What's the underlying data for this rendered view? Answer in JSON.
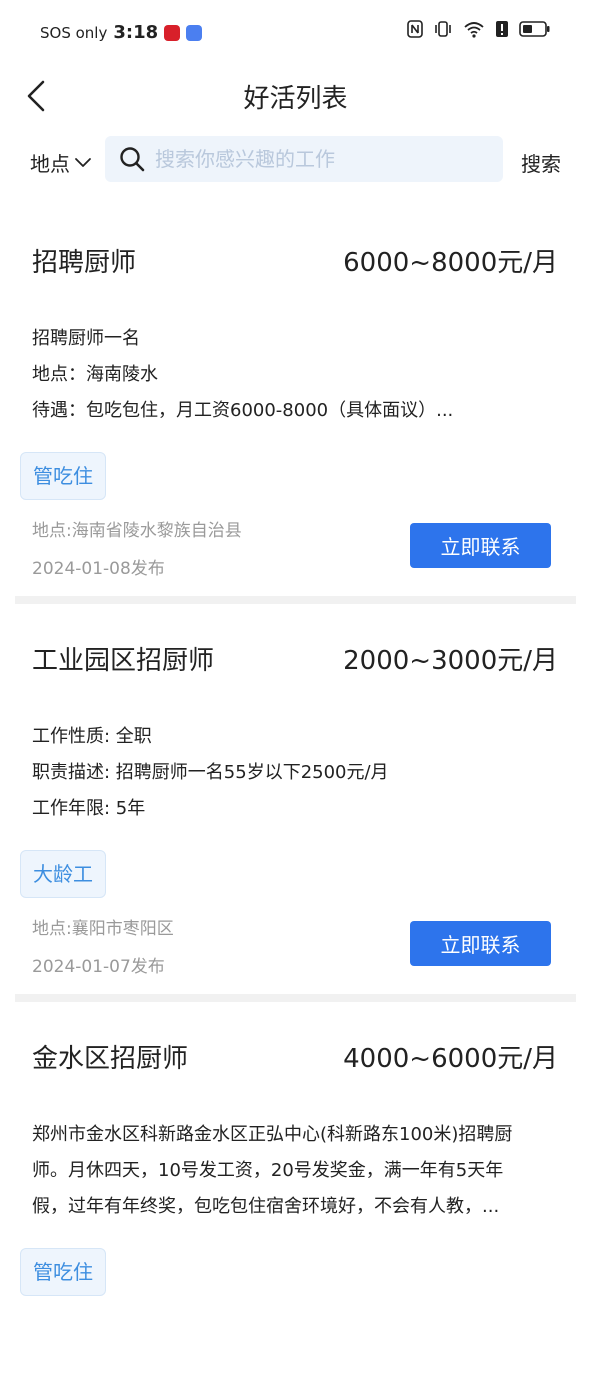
{
  "status_bar": {
    "carrier": "SOS only",
    "time": "3:18"
  },
  "header": {
    "title": "好活列表"
  },
  "search": {
    "location_label": "地点",
    "placeholder": "搜索你感兴趣的工作",
    "value": "",
    "button_label": "搜索"
  },
  "jobs": [
    {
      "title": "招聘厨师",
      "salary": "6000~8000元/月",
      "lines": [
        "招聘厨师一名",
        "地点：海南陵水",
        "待遇：包吃包住，月工资6000-8000（具体面议）..."
      ],
      "tag": "管吃住",
      "location": "地点:海南省陵水黎族自治县",
      "date": "2024-01-08发布",
      "contact_label": "立即联系"
    },
    {
      "title": "工业园区招厨师",
      "salary": "2000~3000元/月",
      "lines": [
        "工作性质: 全职",
        "职责描述: 招聘厨师一名55岁以下2500元/月",
        "工作年限: 5年"
      ],
      "tag": "大龄工",
      "location": "地点:襄阳市枣阳区",
      "date": "2024-01-07发布",
      "contact_label": "立即联系"
    },
    {
      "title": "金水区招厨师",
      "salary": "4000~6000元/月",
      "lines": [
        "郑州市金水区科新路金水区正弘中心(科新路东100米)招聘厨",
        "师。月休四天，10号发工资，20号发奖金，满一年有5天年",
        "假，过年有年终奖，包吃包住宿舍环境好，不会有人教，..."
      ],
      "tag": "管吃住",
      "location": "",
      "date": "",
      "contact_label": ""
    }
  ]
}
